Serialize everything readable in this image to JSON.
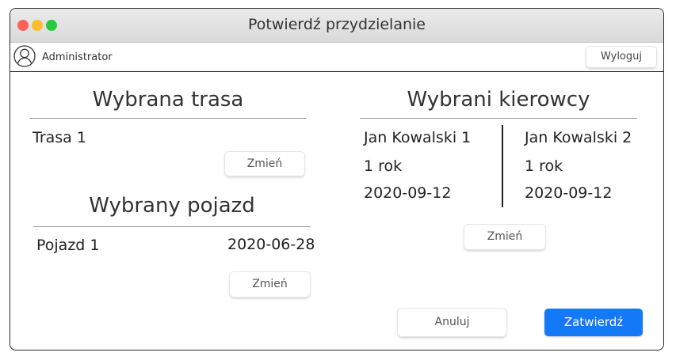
{
  "window": {
    "title": "Potwierdź przydzielanie"
  },
  "user": {
    "name": "Administrator",
    "logout_label": "Wyloguj"
  },
  "route": {
    "heading": "Wybrana trasa",
    "name": "Trasa 1",
    "change_label": "Zmień"
  },
  "vehicle": {
    "heading": "Wybrany pojazd",
    "name": "Pojazd 1",
    "date": "2020-06-28",
    "change_label": "Zmień"
  },
  "drivers": {
    "heading": "Wybrani kierowcy",
    "list": [
      {
        "name": "Jan Kowalski 1",
        "experience": "1 rok",
        "date": "2020-09-12"
      },
      {
        "name": "Jan Kowalski 2",
        "experience": "1 rok",
        "date": "2020-09-12"
      }
    ],
    "change_label": "Zmień"
  },
  "actions": {
    "cancel_label": "Anuluj",
    "confirm_label": "Zatwierdź"
  },
  "colors": {
    "accent": "#1479f6",
    "close": "#fe5f57",
    "minimize": "#febc2e",
    "maximize": "#28c840"
  },
  "icons": {
    "avatar": "user-circle-icon"
  }
}
